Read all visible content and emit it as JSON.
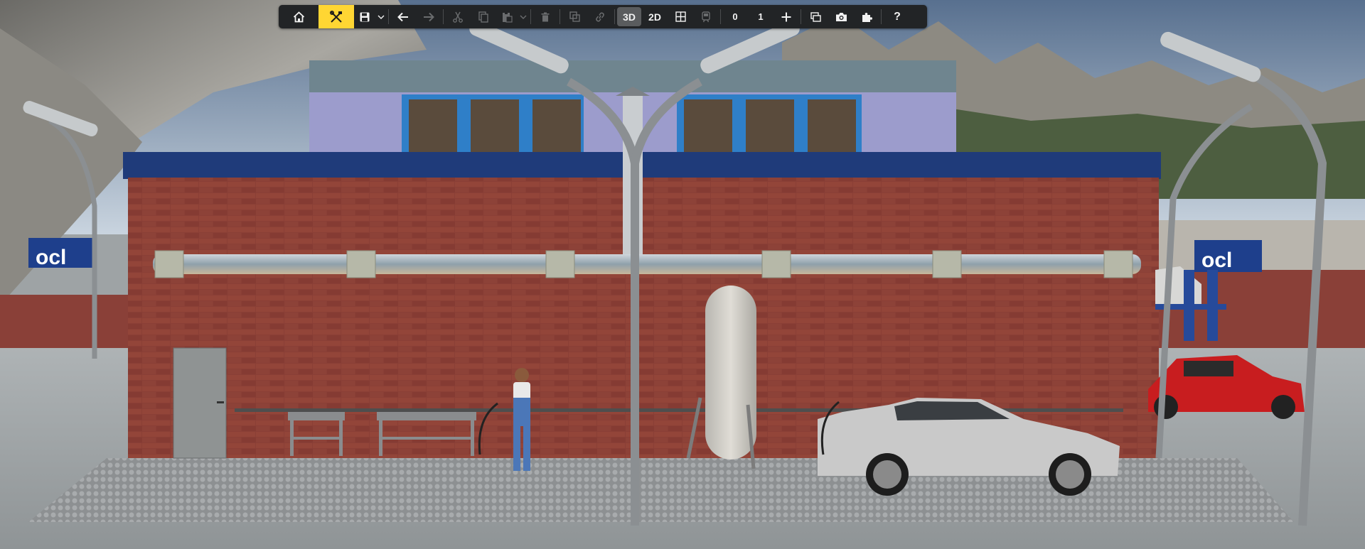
{
  "app": {
    "toolbar": {
      "home": {
        "icon": "home-icon"
      },
      "edit_mode": {
        "icon": "tools-icon",
        "active": true,
        "accent": "#ffd633"
      },
      "save": {
        "icon": "save-icon"
      },
      "undo": {
        "icon": "arrow-left-icon"
      },
      "redo": {
        "icon": "arrow-right-icon"
      },
      "cut": {
        "icon": "scissors-icon"
      },
      "copy": {
        "icon": "copy-icon"
      },
      "paste": {
        "icon": "paste-icon"
      },
      "delete": {
        "icon": "trash-icon"
      },
      "group": {
        "icon": "group-icon"
      },
      "link": {
        "icon": "link-icon"
      },
      "view_3d_label": "3D",
      "view_2d_label": "2D",
      "grid": {
        "icon": "grid-icon"
      },
      "train": {
        "icon": "train-icon"
      },
      "layer_min": "0",
      "layer_max": "1",
      "add": {
        "icon": "plus-icon"
      },
      "window": {
        "icon": "window-icon"
      },
      "screenshot": {
        "icon": "camera-icon"
      },
      "plugins": {
        "icon": "puzzle-icon"
      },
      "help_label": "?"
    }
  },
  "colors": {
    "toolbar_bg": "#222426",
    "active_mode": "#ffd633",
    "brick": "#8a3f36",
    "roof_trim": "#1f3b7a",
    "sky": "#6f8fb3"
  }
}
